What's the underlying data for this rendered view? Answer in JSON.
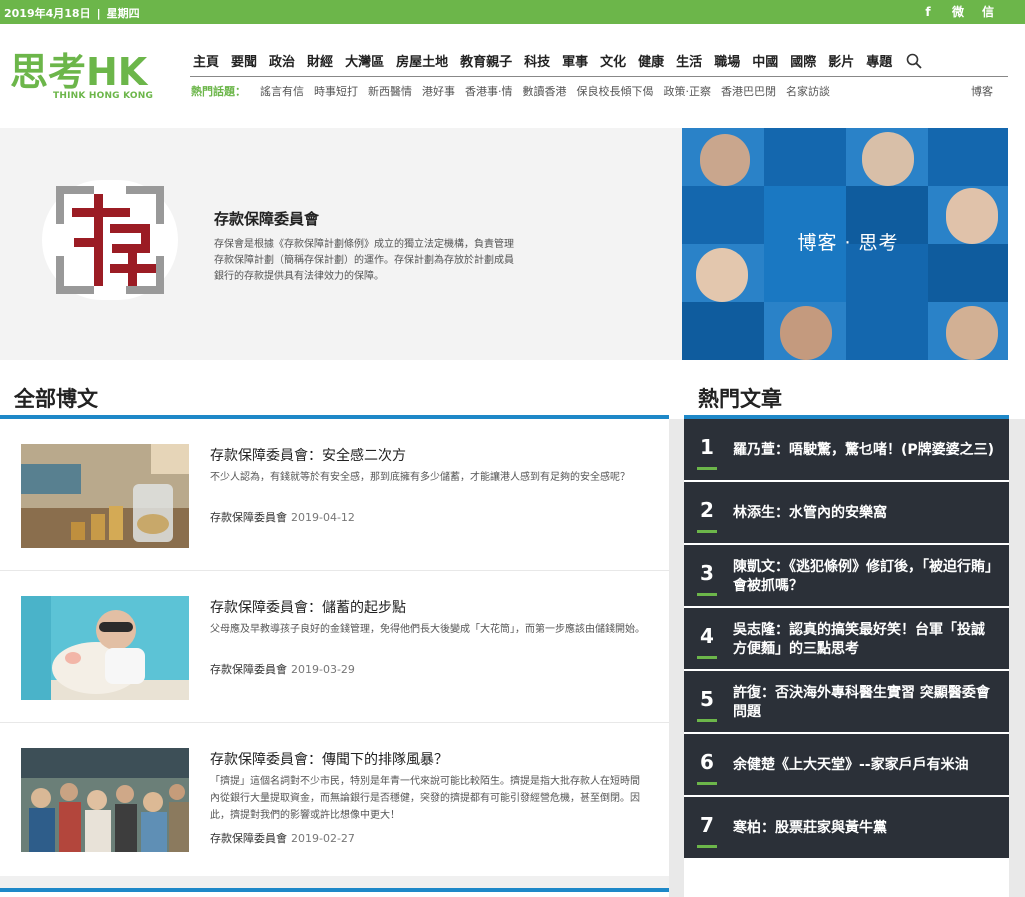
{
  "topbar": {
    "date": "2019年4月18日",
    "separator": "|",
    "weekday": "星期四",
    "social": [
      {
        "icon": "facebook-icon",
        "glyph": "f"
      },
      {
        "icon": "weibo-icon",
        "glyph": "微"
      },
      {
        "icon": "wechat-icon",
        "glyph": "信"
      }
    ]
  },
  "logo": {
    "text": "思考HK",
    "tagline": "THINK HONG KONG",
    "green": "#6cb64a",
    "blue": "#1e88c8"
  },
  "nav": {
    "items": [
      "主頁",
      "要聞",
      "政治",
      "財經",
      "大灣區",
      "房屋土地",
      "教育親子",
      "科技",
      "軍事",
      "文化",
      "健康",
      "生活",
      "職場",
      "中國",
      "國際",
      "影片",
      "專題"
    ],
    "search_icon": "search-icon"
  },
  "hot_topics": {
    "label": "熱門話題：",
    "items": [
      "謠言有信",
      "時事短打",
      "新西醫情",
      "港好事",
      "香港事·情",
      "數讀香港",
      "保良校長傾下偈",
      "政策·正察",
      "香港巴巴閉",
      "名家訪談"
    ],
    "blog": "博客"
  },
  "author": {
    "name": "存款保障委員會",
    "description": "存保會是根據《存款保障計劃條例》成立的獨立法定機構，負責管理存款保障計劃（簡稱存保計劃）的運作。存保計劃為存放於計劃成員銀行的存款提供具有法律效力的保障。",
    "logo_color": "#9b1c24"
  },
  "blog_banner": {
    "title": "博客 · 思考",
    "color": "#1a78c2"
  },
  "sections": {
    "all_posts": "全部博文",
    "hot_articles": "熱門文章"
  },
  "articles": [
    {
      "title": "存款保障委員會：安全感二次方",
      "excerpt": "不少人認為，有錢就等於有安全感，那到底擁有多少儲蓄，才能讓港人感到有足夠的安全感呢？",
      "author": "存款保障委員會",
      "date": "2019-04-12"
    },
    {
      "title": "存款保障委員會：儲蓄的起步點",
      "excerpt": "父母應及早教導孩子良好的金錢管理，免得他們長大後變成「大花筒」，而第一步應該由儲錢開始。",
      "author": "存款保障委員會",
      "date": "2019-03-29"
    },
    {
      "title": "存款保障委員會：傳聞下的排隊風暴？",
      "excerpt": "「擠提」這個名詞對不少市民，特別是年青一代來說可能比較陌生。擠提是指大批存款人在短時間內從銀行大量提取資金，而無論銀行是否穩健，突發的擠提都有可能引發經營危機，甚至倒閉。因此，擠提對我們的影響或許比想像中更大！",
      "author": "存款保障委員會",
      "date": "2019-02-27"
    }
  ],
  "hot_list": [
    {
      "rank": "1",
      "title": "羅乃萱：唔駛驚，驚乜啫！(P牌婆婆之三)"
    },
    {
      "rank": "2",
      "title": "林添生：水管內的安樂窩"
    },
    {
      "rank": "3",
      "title": "陳凱文：《逃犯條例》修訂後，「被迫行賄」會被抓嗎？"
    },
    {
      "rank": "4",
      "title": "吳志隆：認真的搞笑最好笑！台軍「投誠方便麵」的三點思考"
    },
    {
      "rank": "5",
      "title": "許復：否決海外專科醫生實習 突顯醫委會問題"
    },
    {
      "rank": "6",
      "title": "余健楚《上大天堂》--家家戶戶有米油"
    },
    {
      "rank": "7",
      "title": "寒柏：股票莊家與黃牛黨"
    }
  ]
}
